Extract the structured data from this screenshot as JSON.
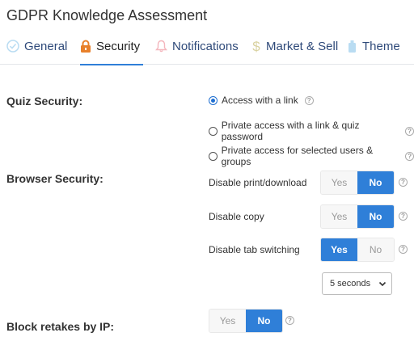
{
  "page": {
    "title": "GDPR Knowledge Assessment"
  },
  "tabs": [
    {
      "label": "General",
      "icon": "check-circle-icon"
    },
    {
      "label": "Security",
      "icon": "lock-icon",
      "active": true
    },
    {
      "label": "Notifications",
      "icon": "bell-icon"
    },
    {
      "label": "Market & Sell",
      "icon": "dollar-icon"
    },
    {
      "label": "Theme",
      "icon": "theme-icon"
    }
  ],
  "quiz_security": {
    "label": "Quiz Security:",
    "options": [
      {
        "label": "Access with a link",
        "checked": true
      },
      {
        "label": "Private access with a link & quiz password",
        "checked": false
      },
      {
        "label": "Private access for selected users & groups",
        "checked": false
      }
    ]
  },
  "browser_security": {
    "label": "Browser Security:",
    "settings": [
      {
        "label": "Disable print/download",
        "yes": "Yes",
        "no": "No",
        "value": "No"
      },
      {
        "label": "Disable copy",
        "yes": "Yes",
        "no": "No",
        "value": "No"
      },
      {
        "label": "Disable tab switching",
        "yes": "Yes",
        "no": "No",
        "value": "Yes"
      }
    ],
    "tab_switch_interval": "5 seconds"
  },
  "block_retakes": {
    "label": "Block retakes by IP:",
    "yes": "Yes",
    "no": "No",
    "value": "No"
  },
  "help_glyph": "?",
  "colors": {
    "accent": "#2f7fd8",
    "tab_text": "#2f4a7a",
    "lock_orange": "#e8802a"
  }
}
